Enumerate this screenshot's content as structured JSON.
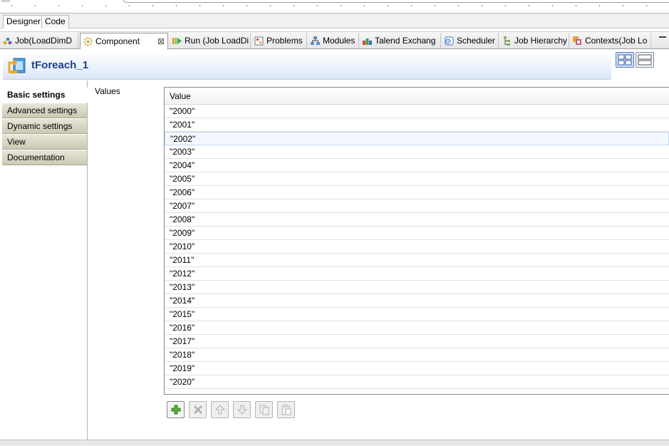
{
  "editor_tabs": {
    "designer": "Designer",
    "code": "Code"
  },
  "view_tabs": [
    {
      "label": "Job(LoadDimD",
      "icon": "job-icon"
    },
    {
      "label": "Component",
      "icon": "component-icon"
    },
    {
      "label": "Run (Job LoadDi",
      "icon": "run-icon"
    },
    {
      "label": "Problems",
      "icon": "problems-icon"
    },
    {
      "label": "Modules",
      "icon": "modules-icon"
    },
    {
      "label": "Talend Exchang",
      "icon": "exchange-icon"
    },
    {
      "label": "Scheduler",
      "icon": "scheduler-icon"
    },
    {
      "label": "Job Hierarchy",
      "icon": "hierarchy-icon"
    },
    {
      "label": "Contexts(Job Lo",
      "icon": "contexts-icon"
    }
  ],
  "component": {
    "title": "tForeach_1",
    "icon": "tforeach-icon"
  },
  "nav": {
    "items": [
      "Basic settings",
      "Advanced settings",
      "Dynamic settings",
      "View",
      "Documentation"
    ],
    "active": "Basic settings"
  },
  "values_section": {
    "label": "Values",
    "column_header": "Value",
    "rows": [
      "\"2000\"",
      "\"2001\"",
      "\"2002\"",
      "\"2003\"",
      "\"2004\"",
      "\"2005\"",
      "\"2006\"",
      "\"2007\"",
      "\"2008\"",
      "\"2009\"",
      "\"2010\"",
      "\"2011\"",
      "\"2012\"",
      "\"2013\"",
      "\"2014\"",
      "\"2015\"",
      "\"2016\"",
      "\"2017\"",
      "\"2018\"",
      "\"2019\"",
      "\"2020\""
    ],
    "selected_row": "\"2002\""
  },
  "toolbar": [
    "add-icon",
    "remove-icon",
    "move-up-icon",
    "move-down-icon",
    "copy-icon",
    "paste-icon"
  ],
  "colors": {
    "title": "#1e3f8c",
    "nav_tab": "#d8d7c4",
    "header_gradient": "#dbe4f4"
  }
}
